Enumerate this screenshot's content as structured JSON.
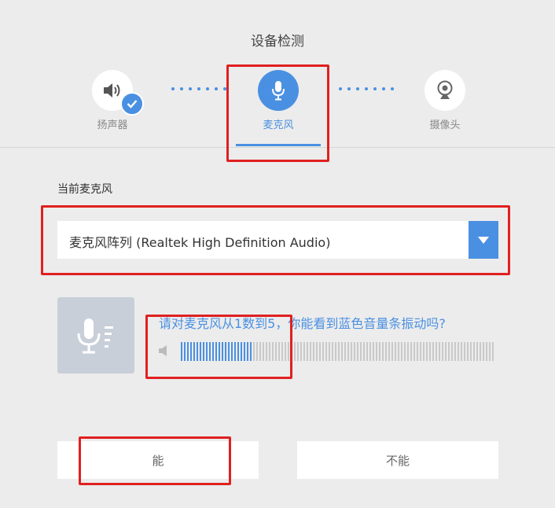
{
  "header": {
    "title": "设备检测"
  },
  "steps": [
    {
      "label": "扬声器",
      "icon": "speaker-icon",
      "status": "completed"
    },
    {
      "label": "麦克风",
      "icon": "microphone-icon",
      "status": "active"
    },
    {
      "label": "摄像头",
      "icon": "camera-icon",
      "status": "pending"
    }
  ],
  "microphone": {
    "section_label": "当前麦克风",
    "selected_device": "麦克风阵列 (Realtek High Definition Audio)"
  },
  "test": {
    "question": "请对麦克风从1数到5，你能看到蓝色音量条振动吗?",
    "volume_level": 0.23
  },
  "buttons": {
    "yes_label": "能",
    "no_label": "不能"
  },
  "colors": {
    "accent": "#4a90e2",
    "highlight_box": "#e02020",
    "meter_inactive": "#c9c9c9"
  }
}
